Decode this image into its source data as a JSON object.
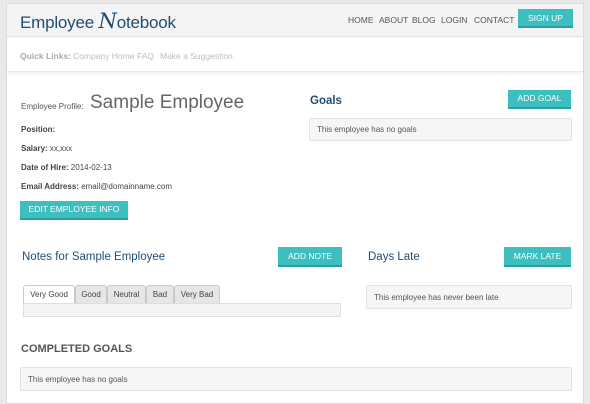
{
  "header": {
    "logo_prefix": "Employee ",
    "logo_n": "N",
    "logo_suffix": "otebook",
    "nav": [
      "HOME",
      "ABOUT",
      "BLOG",
      "LOGIN",
      "CONTACT"
    ],
    "signup_label": "SIGN UP"
  },
  "quick_links": {
    "label": "Quick Links:",
    "links": [
      "Company Home",
      "FAQ",
      "Make a Suggestion"
    ]
  },
  "profile": {
    "label": "Employee Profile:",
    "name": "Sample Employee",
    "position_label": "Position:",
    "position_value": "",
    "salary_label": "Salary:",
    "salary_value": "xx,xxx",
    "hire_label": "Date of Hire:",
    "hire_value": "2014-02-13",
    "email_label": "Email Address:",
    "email_value": "email@domainname.com",
    "edit_button": "EDIT EMPLOYEE INFO"
  },
  "goals": {
    "title": "Goals",
    "add_button": "ADD GOAL",
    "empty_text": "This employee has no goals"
  },
  "notes": {
    "title": "Notes for Sample Employee",
    "add_button": "ADD NOTE",
    "tabs": [
      "Very Good",
      "Good",
      "Neutral",
      "Bad",
      "Very Bad"
    ],
    "active_tab": "Very Good"
  },
  "days_late": {
    "title": "Days Late",
    "mark_button": "MARK LATE",
    "empty_text": "This employee has never been late"
  },
  "completed_goals": {
    "title": "COMPLETED GOALS",
    "empty_text": "This employee has no goals"
  },
  "colors": {
    "accent": "#3dbfc0",
    "brand": "#1f4d74"
  }
}
